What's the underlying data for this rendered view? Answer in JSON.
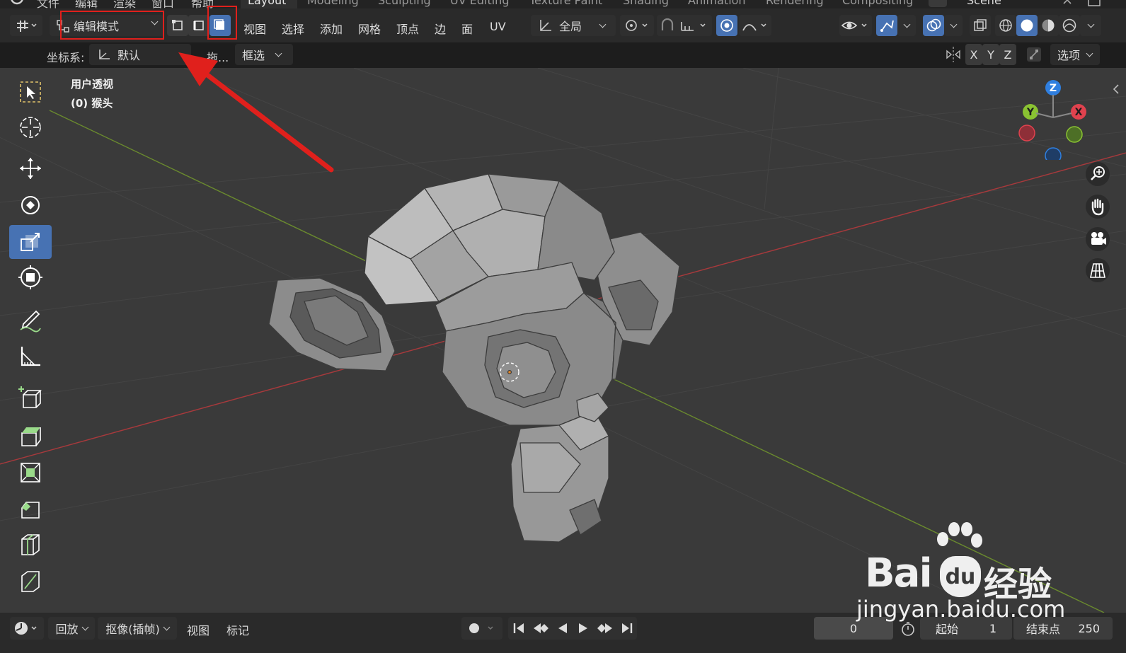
{
  "topbar": {
    "menus": [
      "文件",
      "编辑",
      "渲染",
      "窗口",
      "帮助"
    ],
    "workspaces": [
      "Layout",
      "Modeling",
      "Sculpting",
      "UV Editing",
      "Texture Paint",
      "Shading",
      "Animation",
      "Rendering",
      "Compositing"
    ],
    "active_workspace": "Layout",
    "scene": "Scene"
  },
  "header": {
    "mode": "编辑模式",
    "menus": [
      "视图",
      "选择",
      "添加",
      "网格",
      "顶点",
      "边",
      "面",
      "UV"
    ],
    "transform_orientation": "全局",
    "select_modes": [
      "vertex-select",
      "edge-select",
      "face-select"
    ],
    "active_select_mode": "face-select"
  },
  "toolbar2": {
    "coord_label": "坐标系:",
    "coord_value": "默认",
    "drag_label": "拖...",
    "select_type": "框选",
    "axes": [
      "X",
      "Y",
      "Z"
    ],
    "options_label": "选项"
  },
  "viewport": {
    "view_name": "用户透视",
    "object_name": "(0) 猴头",
    "gizmo_axes": [
      "Z",
      "Y",
      "X"
    ],
    "gizmo_colors": {
      "x": "#e0424e",
      "y": "#8ac332",
      "z": "#2f7fe0"
    },
    "grid_axis_colors": {
      "x": "#a8393c",
      "y": "#6a8a2e"
    }
  },
  "tools": [
    "select-box",
    "cursor",
    "move",
    "rotate",
    "scale",
    "transform",
    "annotate",
    "measure",
    "add-cube",
    "extrude",
    "inset",
    "bevel",
    "loop-cut",
    "knife"
  ],
  "active_tool": "scale",
  "timeline": {
    "playback_label": "回放",
    "keying_label": "抠像(插帧)",
    "view_label": "视图",
    "marker_label": "标记",
    "current_frame": "0",
    "start_label": "起始",
    "start_value": "1",
    "end_label": "结束点",
    "end_value": "250"
  },
  "watermark": {
    "brand": "Bai",
    "brand2": "du",
    "cn": "经验",
    "url": "jingyan.baidu.com"
  },
  "annotation_color": "#e0201c"
}
